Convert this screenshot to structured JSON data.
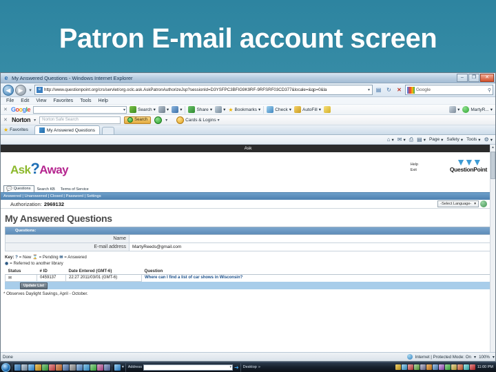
{
  "slide": {
    "title": "Patron E-mail account screen"
  },
  "browser": {
    "window_title": "My Answered Questions - Windows Internet Explorer",
    "window_buttons": {
      "minimize": "–",
      "maximize": "❐",
      "close": "✕"
    },
    "address": {
      "url": "http://www.questionpoint.org/crs/servlet/org.oclc.ask.AskPatronAuthorizeJsp?sessionId=D3YSFPC3BFIG9K9RF-9RFSRF03CD377&locale=&qp=0&la",
      "dropdown_caret": "▾",
      "refresh_icon": "↻",
      "stop_icon": "✕"
    },
    "search": {
      "placeholder": "Google",
      "magnifier": "⚲"
    },
    "menu": [
      "File",
      "Edit",
      "View",
      "Favorites",
      "Tools",
      "Help"
    ],
    "google_toolbar": {
      "close": "✕",
      "logo": [
        "G",
        "o",
        "o",
        "g",
        "l",
        "e"
      ],
      "input_value": "",
      "items": [
        {
          "label": "Search",
          "caret": "▾"
        },
        {
          "label": "",
          "caret": "▾"
        },
        {
          "label": "",
          "caret": "▾"
        },
        {
          "label": "Share",
          "caret": "▾"
        },
        {
          "label": "",
          "caret": "▾"
        },
        {
          "label": "Bookmarks",
          "caret": "▾"
        },
        {
          "label": "Check",
          "caret": "▾"
        },
        {
          "label": "AutoFill",
          "caret": "▾"
        }
      ],
      "account": "MartyR...",
      "account_caret": "▾"
    },
    "norton_toolbar": {
      "close": "✕",
      "logo": "Norton",
      "logo_caret": "▾",
      "search_placeholder": "Norton Safe Search",
      "search_button": "Search",
      "status_caret": "▾",
      "cards_label": "Cards & Logins",
      "cards_caret": "▾"
    },
    "favorites_label": "Favorites",
    "tab_label": "My Answered Questions",
    "command_bar": [
      {
        "label": "",
        "icon": "⌂",
        "caret": "▾"
      },
      {
        "label": "",
        "icon": "✉",
        "caret": "▾"
      },
      {
        "label": "",
        "icon": "⎙",
        "caret": ""
      },
      {
        "label": "",
        "icon": "▤",
        "caret": "▾"
      },
      {
        "label": "Page",
        "icon": "",
        "caret": "▾"
      },
      {
        "label": "Safety",
        "icon": "",
        "caret": "▾"
      },
      {
        "label": "Tools",
        "icon": "",
        "caret": "▾"
      },
      {
        "label": "",
        "icon": "⚙",
        "caret": "▾"
      }
    ]
  },
  "page": {
    "dark_band": "Ask",
    "logo": {
      "part1": "Ask",
      "question_mark": "?",
      "part2": "Away"
    },
    "help_link": "Help",
    "exit_link": "Exit",
    "questionpoint_brand": "QuestionPoint",
    "tabs": [
      {
        "label": "Questions",
        "active": true
      },
      {
        "label": "Search KB",
        "active": false
      },
      {
        "label": "Terms of Service",
        "active": false
      }
    ],
    "subnav": "Answered | Unanswered | Closed | Password | Settings",
    "authorization_label": "Authorization:",
    "authorization_value": "2969132",
    "language_selector": "-Select Language-",
    "language_caret": "▾",
    "heading": "My Answered Questions",
    "form": {
      "section_title": "Questions:",
      "rows": [
        {
          "label": "Name",
          "value": ""
        },
        {
          "label": "E-mail address",
          "value": "MartyReeds@gmail.com"
        }
      ]
    },
    "key": {
      "prefix": "Key:",
      "items": [
        {
          "icon": "?",
          "label": "= New"
        },
        {
          "icon": "⌛",
          "label": "= Pending"
        },
        {
          "icon": "✉",
          "label": "= Answered"
        }
      ],
      "referred_icon": "◉",
      "referred_label": "= Referred to another library"
    },
    "list": {
      "headers": [
        "Status",
        "# ID",
        "Date Entered (GMT-6)",
        "Question"
      ],
      "rows": [
        {
          "status_icon": "✉",
          "id": "0459137",
          "date": "22:27 2011/03/01 (GMT-6)",
          "question": "Where can I find a list of car shows in Wisconsin?"
        }
      ]
    },
    "update_button": "Update List",
    "footnote": "* Observes Daylight Savings, April - October."
  },
  "status_bar": {
    "message": "Done",
    "zone": "Internet | Protected Mode: On",
    "zone_caret": "▾",
    "zoom": "100%",
    "zoom_caret": "▾"
  },
  "taskbar": {
    "start": "",
    "ie_caret": "▾",
    "address_label": "Address",
    "address_value": "",
    "address_caret": "▾",
    "go_arrow": "➜",
    "desktop_label": "Desktop",
    "desktop_chevron": "»",
    "clock": "11:00 PM"
  },
  "colors": {
    "slide_bg_top": "#2d84a0",
    "slide_bg_bottom": "#8cbcc8",
    "subnav_blue": "#5e8cb8",
    "table_header_blue": "#6e9cc6",
    "update_band": "#a8cdea",
    "link_blue": "#1a4f8a",
    "logo_ask": "#8cb82b",
    "logo_qm": "#1f6fb5",
    "logo_away": "#b5258f"
  }
}
